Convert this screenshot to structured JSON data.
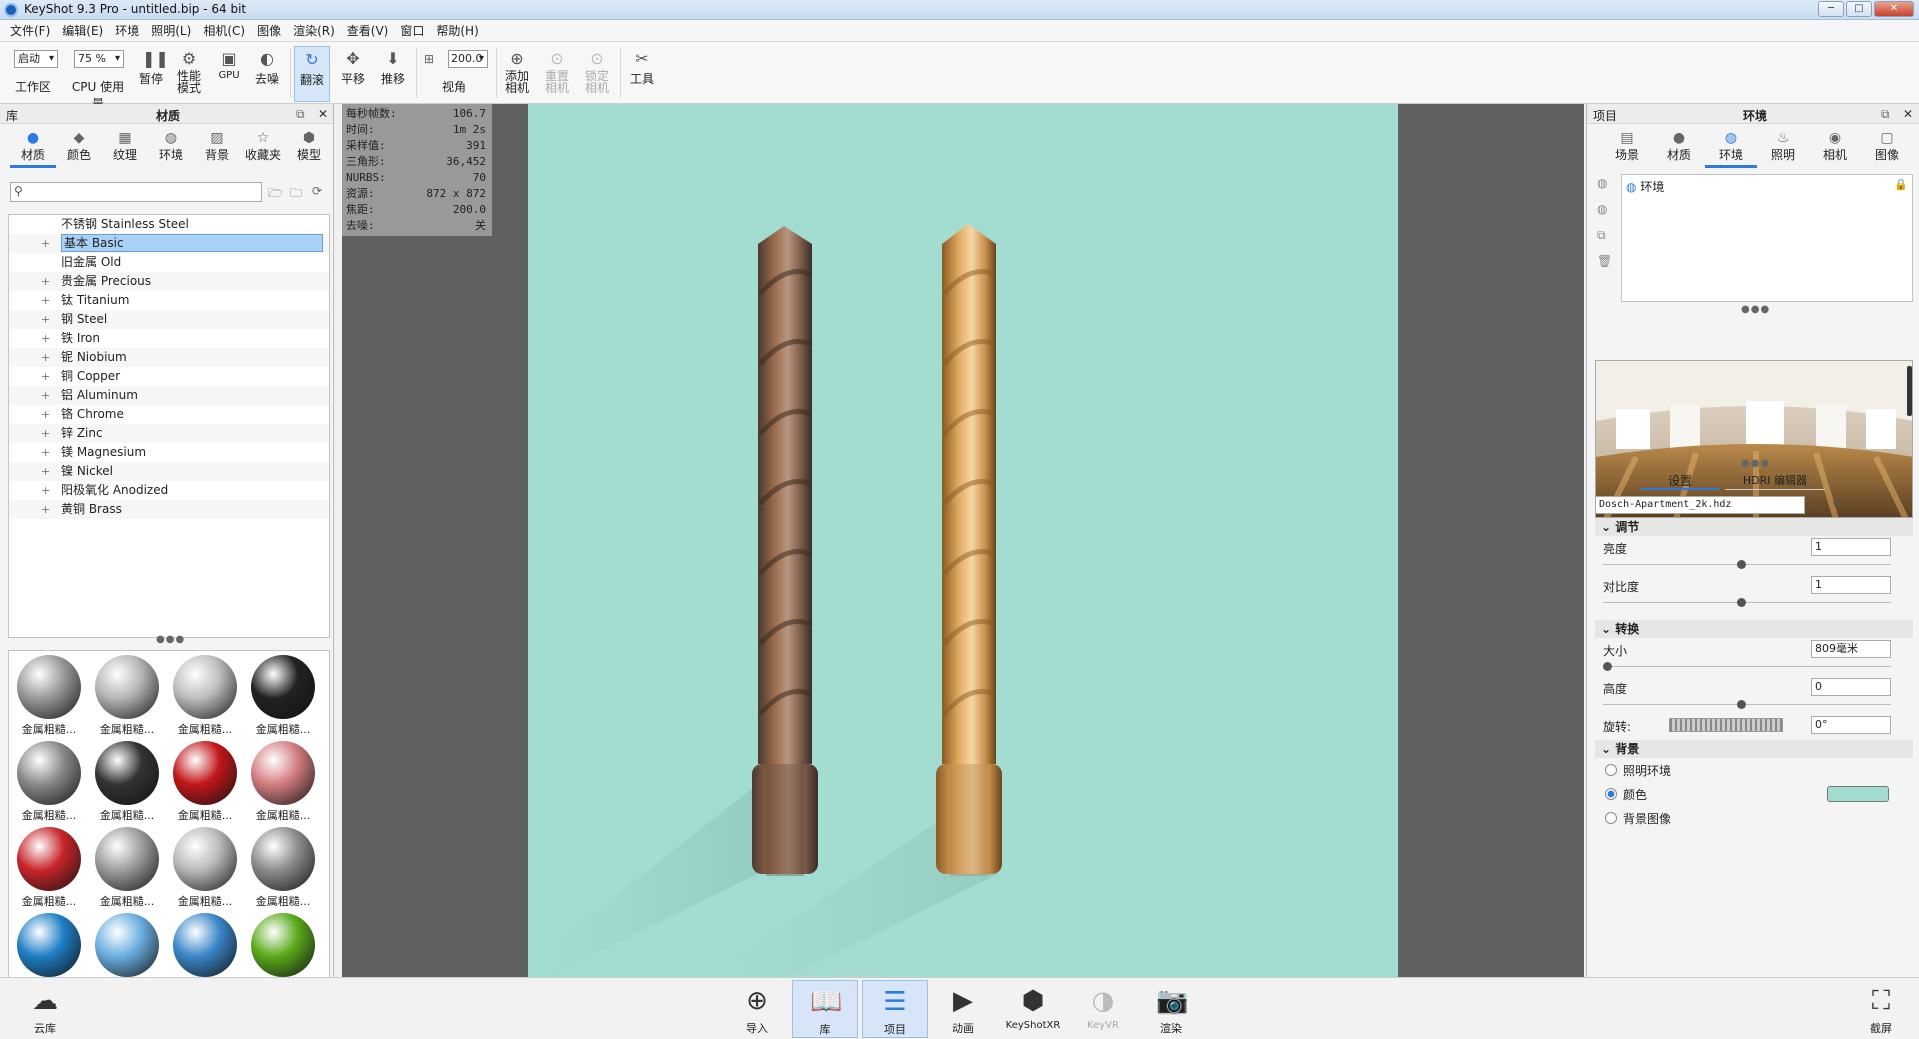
{
  "window": {
    "title": "KeyShot 9.3 Pro  - untitled.bip  - 64 bit",
    "min": "─",
    "max": "□",
    "close": "✕"
  },
  "menu": [
    "文件(F)",
    "编辑(E)",
    "环境",
    "照明(L)",
    "相机(C)",
    "图像",
    "渲染(R)",
    "查看(V)",
    "窗口",
    "帮助(H)"
  ],
  "toolbar": {
    "mode_select": "启动",
    "mode_label": "工作区",
    "cpu_select": "75 %",
    "cpu_label": "CPU 使用量",
    "pause": "暂停",
    "perf": "性能\n模式",
    "gpu": "GPU",
    "denoise": "去噪",
    "tumble": "翻滚",
    "pan": "平移",
    "dolly": "推移",
    "fov_value": "200.0",
    "fov_label": "视角",
    "add_cam": "添加\n相机",
    "reset_cam": "重置\n相机",
    "lock_cam": "锁定\n相机",
    "tools": "工具"
  },
  "library": {
    "header_left": "库",
    "header_title": "材质",
    "tabs": [
      "材质",
      "颜色",
      "纹理",
      "环境",
      "背景",
      "收藏夹",
      "模型"
    ],
    "search_placeholder": "",
    "tree": [
      {
        "label": "不锈钢 Stainless Steel",
        "plus": ""
      },
      {
        "label": "基本 Basic",
        "plus": "+",
        "selected": true
      },
      {
        "label": "旧金属 Old",
        "plus": ""
      },
      {
        "label": "贵金属 Precious",
        "plus": "+"
      },
      {
        "label": "钛 Titanium",
        "plus": "+"
      },
      {
        "label": "钢 Steel",
        "plus": "+"
      },
      {
        "label": "铁 Iron",
        "plus": "+"
      },
      {
        "label": "铌 Niobium",
        "plus": "+"
      },
      {
        "label": "铜 Copper",
        "plus": "+"
      },
      {
        "label": "铝 Aluminum",
        "plus": "+"
      },
      {
        "label": "铬 Chrome",
        "plus": "+"
      },
      {
        "label": "锌 Zinc",
        "plus": "+"
      },
      {
        "label": "镁 Magnesium",
        "plus": "+"
      },
      {
        "label": "镍 Nickel",
        "plus": "+"
      },
      {
        "label": "阳极氧化 Anodized",
        "plus": "+"
      },
      {
        "label": "黄铜 Brass",
        "plus": "+"
      }
    ],
    "thumb_label": "金属粗糙...",
    "thumb_colors": [
      "#9a9a9a",
      "#b5b5b5",
      "#bdbdbd",
      "#222222",
      "#8a8a8a",
      "#333333",
      "#c2161a",
      "#d47d80",
      "#c8252a",
      "#9d9d9d",
      "#b9b9b9",
      "#8d8d8d",
      "#1f7fc6",
      "#6aaee0",
      "#3a86c8",
      "#5aaa1a",
      "#7cc43a",
      "#6ab02a",
      "#aaaaaa",
      "#bbbbbb"
    ]
  },
  "hud": [
    {
      "k": "每秒帧数:",
      "v": "106.7"
    },
    {
      "k": "时间:",
      "v": "1m 2s"
    },
    {
      "k": "采样值:",
      "v": "391"
    },
    {
      "k": "三角形:",
      "v": "36,452"
    },
    {
      "k": "NURBS:",
      "v": "70"
    },
    {
      "k": "资源:",
      "v": "872 x 872"
    },
    {
      "k": "焦距:",
      "v": "200.0"
    },
    {
      "k": "去噪:",
      "v": "关"
    }
  ],
  "project": {
    "header_left": "项目",
    "header_title": "环境",
    "tabs": [
      "场景",
      "材质",
      "环境",
      "照明",
      "相机",
      "图像"
    ],
    "env_item": "环境",
    "subtabs": [
      "设置",
      "HDRI 编辑器"
    ],
    "hdri_file": "Dosch-Apartment_2k.hdz",
    "sec_adjust": "调节",
    "brightness_label": "亮度",
    "brightness": "1",
    "contrast_label": "对比度",
    "contrast": "1",
    "sec_transform": "转换",
    "size_label": "大小",
    "size": "809毫米",
    "height_label": "高度",
    "height": "0",
    "rotation_label": "旋转:",
    "rotation": "0°",
    "sec_background": "背景",
    "bg_opts": [
      "照明环境",
      "颜色",
      "背景图像"
    ],
    "bg_color": "#a3dcd1"
  },
  "bottom": [
    "云库",
    "导入",
    "库",
    "项目",
    "动画",
    "KeyShotXR",
    "KeyVR",
    "渲染",
    "截屏"
  ]
}
